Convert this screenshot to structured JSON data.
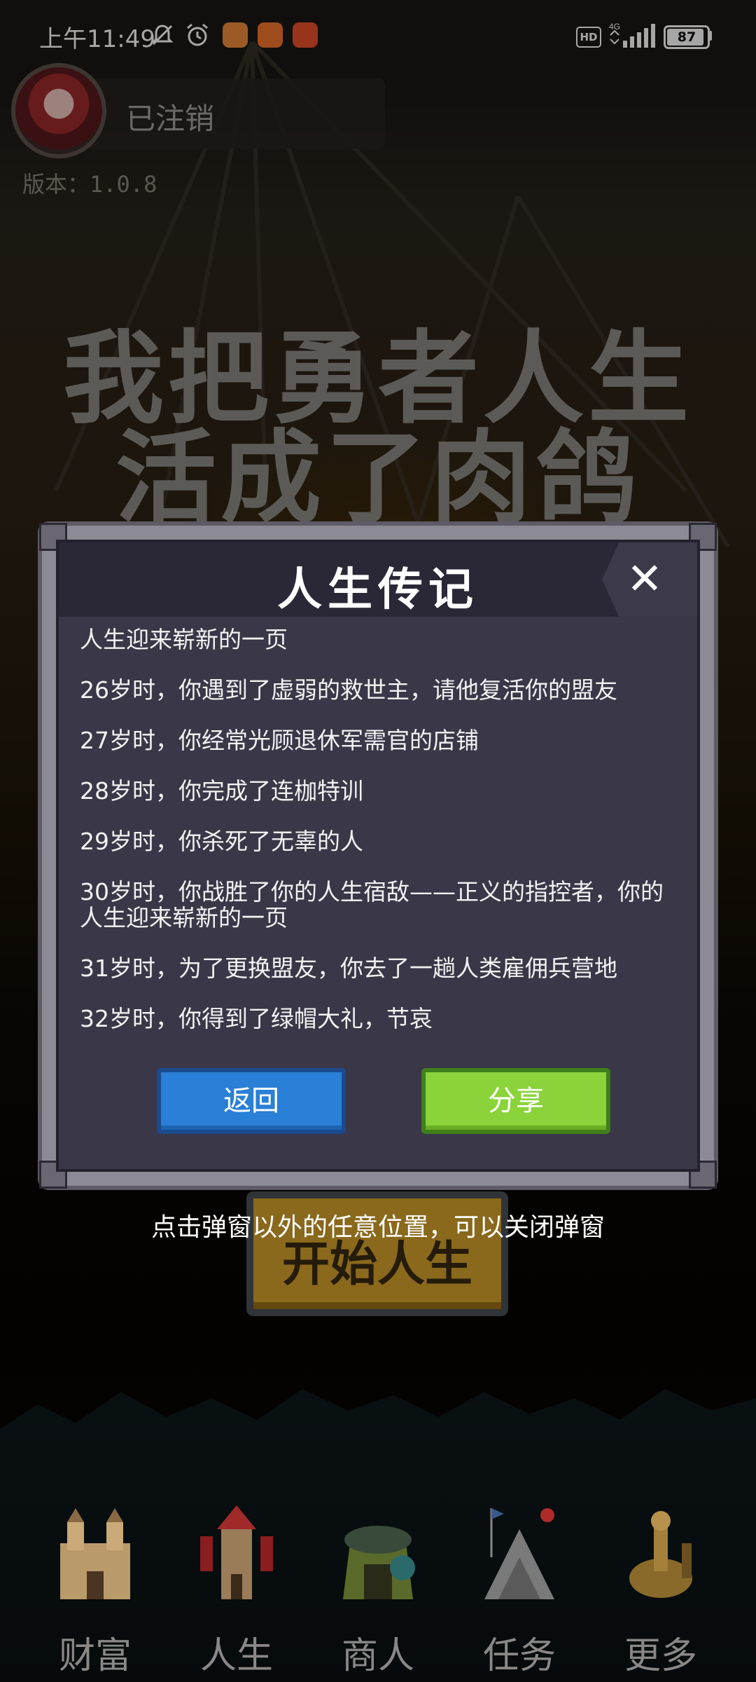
{
  "status_bar": {
    "time": "上午11:49",
    "network": "4G",
    "hd": "HD",
    "battery": "87"
  },
  "profile": {
    "name": "已注销",
    "version": "版本：1.0.8"
  },
  "game_title": {
    "line1": "我把勇者人生",
    "line2": "活成了肉鸽"
  },
  "start_button": {
    "label": "开始人生"
  },
  "modal": {
    "title": "人生传记",
    "close": "✕",
    "events": [
      "人生迎来崭新的一页",
      "26岁时，你遇到了虚弱的救世主，请他复活你的盟友",
      "27岁时，你经常光顾退休军需官的店铺",
      "28岁时，你完成了连枷特训",
      "29岁时，你杀死了无辜的人",
      "30岁时，你战胜了你的人生宿敌——正义的指控者，你的人生迎来崭新的一页",
      "31岁时，为了更换盟友，你去了一趟人类雇佣兵营地",
      "32岁时，你得到了绿帽大礼，节哀"
    ],
    "back_label": "返回",
    "share_label": "分享"
  },
  "hint": "点击弹窗以外的任意位置，可以关闭弹窗",
  "nav": {
    "items": [
      {
        "label": "财富",
        "icon": "castle-icon"
      },
      {
        "label": "人生",
        "icon": "tower-icon"
      },
      {
        "label": "商人",
        "icon": "merchant-tent-icon"
      },
      {
        "label": "任务",
        "icon": "quest-pyramid-icon"
      },
      {
        "label": "更多",
        "icon": "workshop-icon"
      }
    ]
  },
  "colors": {
    "modal_bg": "#3a3748",
    "back_button": "#2a7fd6",
    "share_button": "#8ad33a"
  }
}
